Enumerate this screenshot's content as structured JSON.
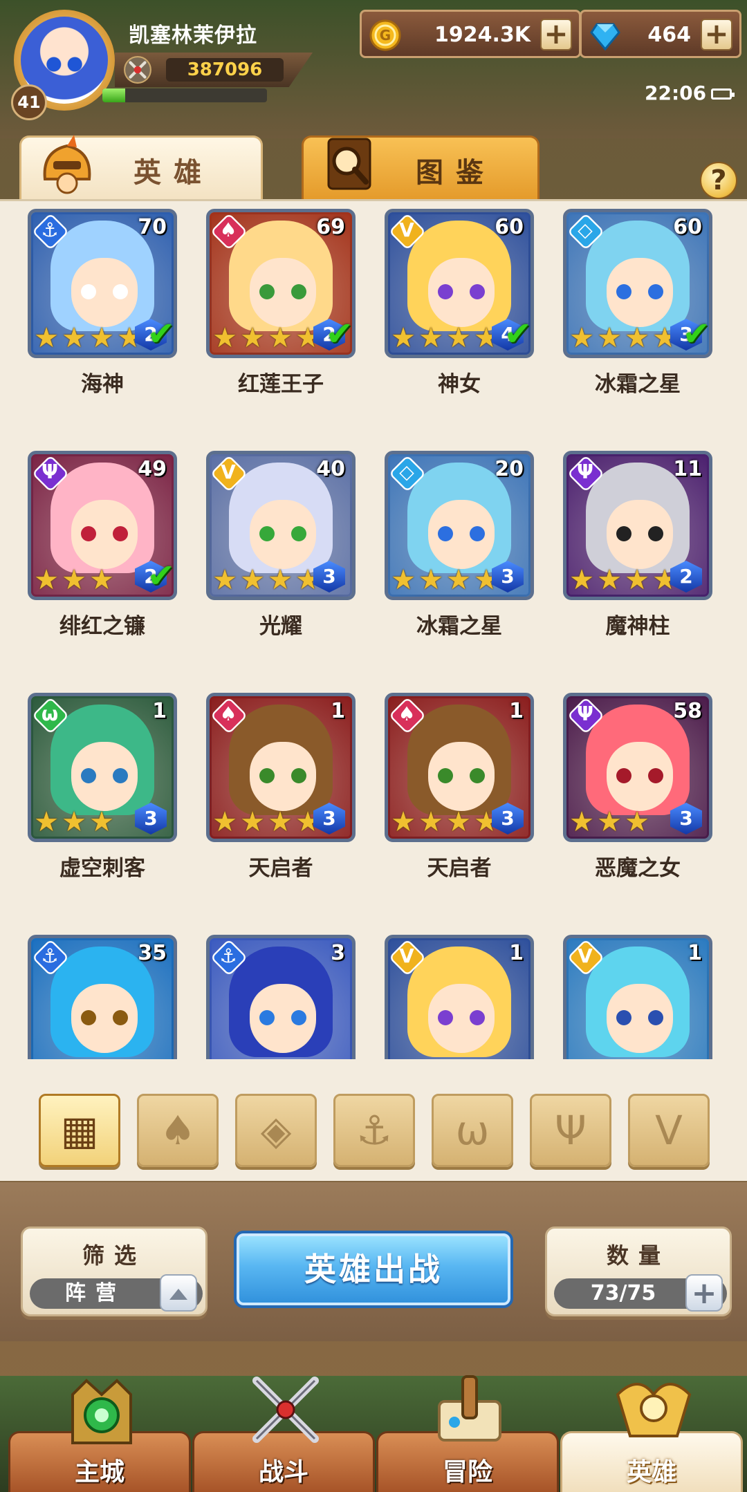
{
  "player": {
    "name": "凯塞林茉伊拉",
    "level": "41",
    "power": "387096",
    "exp_fraction": 0.14
  },
  "currencies": {
    "gold": "1924.3K",
    "gems": "464",
    "gold_icon": "gold-coin-icon",
    "gem_icon": "diamond-icon"
  },
  "status": {
    "time": "22:06"
  },
  "tabs": [
    {
      "label": "英雄",
      "icon": "knight-helmet-icon",
      "active": true
    },
    {
      "label": "图鉴",
      "icon": "magnifier-book-icon",
      "active": false
    }
  ],
  "help": {
    "label": "?"
  },
  "heroes": [
    {
      "name": "海神",
      "level": "70",
      "faction": "anchor",
      "stars": 4,
      "skill": "2",
      "deployed": true
    },
    {
      "name": "红莲王子",
      "level": "69",
      "faction": "fire",
      "stars": 4,
      "skill": "2",
      "deployed": true
    },
    {
      "name": "神女",
      "level": "60",
      "faction": "light",
      "stars": 4,
      "skill": "4",
      "deployed": true
    },
    {
      "name": "冰霜之星",
      "level": "60",
      "faction": "ice",
      "stars": 4,
      "skill": "3",
      "deployed": true
    },
    {
      "name": "绯红之镰",
      "level": "49",
      "faction": "dark",
      "stars": 3,
      "skill": "2",
      "deployed": true
    },
    {
      "name": "光耀",
      "level": "40",
      "faction": "light",
      "stars": 4,
      "skill": "3",
      "deployed": false
    },
    {
      "name": "冰霜之星",
      "level": "20",
      "faction": "ice",
      "stars": 4,
      "skill": "3",
      "deployed": false
    },
    {
      "name": "魔神柱",
      "level": "11",
      "faction": "dark",
      "stars": 4,
      "skill": "2",
      "deployed": false
    },
    {
      "name": "虚空刺客",
      "level": "1",
      "faction": "nature",
      "stars": 3,
      "skill": "3",
      "deployed": false
    },
    {
      "name": "天启者",
      "level": "1",
      "faction": "fire",
      "stars": 4,
      "skill": "3",
      "deployed": false
    },
    {
      "name": "天启者",
      "level": "1",
      "faction": "fire",
      "stars": 4,
      "skill": "3",
      "deployed": false
    },
    {
      "name": "恶魔之女",
      "level": "58",
      "faction": "dark",
      "stars": 3,
      "skill": "3",
      "deployed": false
    },
    {
      "name": "",
      "level": "35",
      "faction": "anchor",
      "stars": 0,
      "skill": "",
      "deployed": false
    },
    {
      "name": "",
      "level": "3",
      "faction": "anchor",
      "stars": 0,
      "skill": "",
      "deployed": false
    },
    {
      "name": "",
      "level": "1",
      "faction": "light",
      "stars": 0,
      "skill": "",
      "deployed": false
    },
    {
      "name": "",
      "level": "1",
      "faction": "light",
      "stars": 0,
      "skill": "",
      "deployed": false
    }
  ],
  "faction_filters": [
    {
      "icon": "all-grid-icon",
      "active": true
    },
    {
      "icon": "fire-faction-icon",
      "active": false
    },
    {
      "icon": "ice-faction-icon",
      "active": false
    },
    {
      "icon": "anchor-faction-icon",
      "active": false
    },
    {
      "icon": "nature-faction-icon",
      "active": false
    },
    {
      "icon": "dark-faction-icon",
      "active": false
    },
    {
      "icon": "light-faction-icon",
      "active": false
    }
  ],
  "filter": {
    "title": "筛选",
    "value": "阵营"
  },
  "deploy": {
    "label": "英雄出战"
  },
  "count": {
    "title": "数量",
    "value": "73/75"
  },
  "nav": [
    {
      "label": "主城",
      "icon": "castle-icon",
      "active": false
    },
    {
      "label": "战斗",
      "icon": "crossed-swords-icon",
      "active": false
    },
    {
      "label": "冒险",
      "icon": "map-scroll-icon",
      "active": false
    },
    {
      "label": "英雄",
      "icon": "hero-emblem-icon",
      "active": true
    }
  ],
  "colors": {
    "faction_anchor": "#2a6de0",
    "faction_fire": "#d8305a",
    "faction_light": "#f0b21d",
    "faction_ice": "#2aa6e8",
    "faction_dark": "#7a2fd0",
    "faction_nature": "#2fb84a",
    "deploy_button": "#3f9ee6"
  }
}
